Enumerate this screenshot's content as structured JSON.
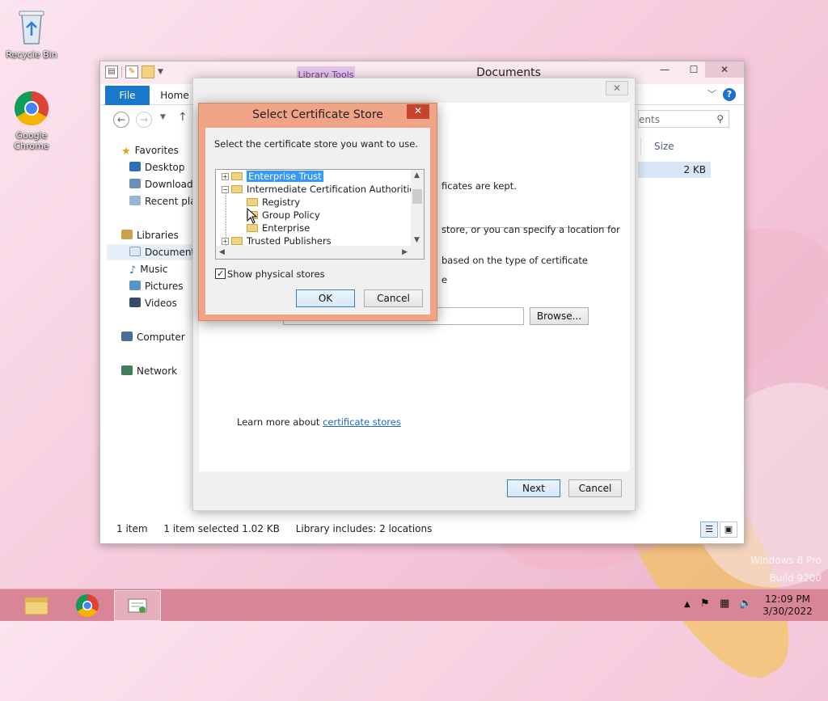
{
  "desktop": {
    "icons": [
      {
        "name": "recycle-bin",
        "label": "Recycle Bin"
      },
      {
        "name": "google-chrome",
        "label": "Google Chrome"
      }
    ],
    "watermark_line1": "Windows 8 Pro",
    "watermark_line2": "Build 9200"
  },
  "explorer": {
    "title": "Documents",
    "library_tools": "Library Tools",
    "tabs": {
      "file": "File",
      "home": "Home"
    },
    "search_placeholder": "ents",
    "nav": {
      "favorites": "Favorites",
      "desktop": "Desktop",
      "downloads": "Downloads",
      "recent": "Recent places",
      "libraries": "Libraries",
      "documents": "Documents",
      "music": "Music",
      "pictures": "Pictures",
      "videos": "Videos",
      "computer": "Computer",
      "network": "Network"
    },
    "column_size": "Size",
    "file_size": "2 KB",
    "status": {
      "items": "1 item",
      "selected": "1 item selected  1.02 KB",
      "library": "Library includes: 2 locations"
    }
  },
  "wizard": {
    "line1": "ficates are kept.",
    "line2": "store, or you can specify a location for",
    "line3": "based on the type of certificate",
    "line4": "e",
    "browse": "Browse...",
    "learn_more": "Learn more about ",
    "link": "certificate stores",
    "next": "Next",
    "cancel": "Cancel"
  },
  "select_store": {
    "title": "Select Certificate Store",
    "prompt": "Select the certificate store you want to use.",
    "tree": {
      "enterprise_trust": "Enterprise Trust",
      "intermediate": "Intermediate Certification Authorities",
      "registry": "Registry",
      "group_policy": "Group Policy",
      "enterprise": "Enterprise",
      "trusted_publishers": "Trusted Publishers"
    },
    "show_physical": "Show physical stores",
    "show_physical_checked": true,
    "ok": "OK",
    "cancel": "Cancel"
  },
  "taskbar": {
    "time": "12:09 PM",
    "date": "3/30/2022"
  },
  "colors": {
    "accent": "#1979ca",
    "selection": "#3399ff",
    "dialog_frame": "#f0a385",
    "close_red": "#c7422f",
    "taskbar": "#d98598"
  }
}
